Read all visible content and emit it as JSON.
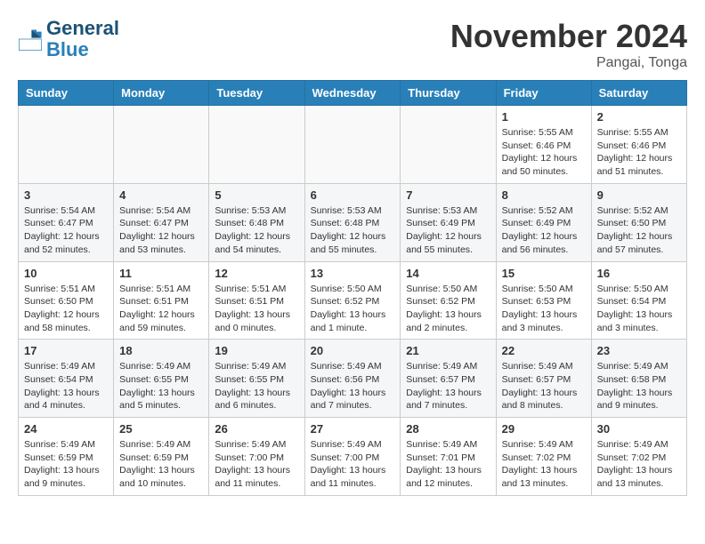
{
  "header": {
    "logo_line1": "General",
    "logo_line2": "Blue",
    "month_title": "November 2024",
    "location": "Pangai, Tonga"
  },
  "weekdays": [
    "Sunday",
    "Monday",
    "Tuesday",
    "Wednesday",
    "Thursday",
    "Friday",
    "Saturday"
  ],
  "weeks": [
    [
      {
        "day": "",
        "detail": ""
      },
      {
        "day": "",
        "detail": ""
      },
      {
        "day": "",
        "detail": ""
      },
      {
        "day": "",
        "detail": ""
      },
      {
        "day": "",
        "detail": ""
      },
      {
        "day": "1",
        "detail": "Sunrise: 5:55 AM\nSunset: 6:46 PM\nDaylight: 12 hours and 50 minutes."
      },
      {
        "day": "2",
        "detail": "Sunrise: 5:55 AM\nSunset: 6:46 PM\nDaylight: 12 hours and 51 minutes."
      }
    ],
    [
      {
        "day": "3",
        "detail": "Sunrise: 5:54 AM\nSunset: 6:47 PM\nDaylight: 12 hours and 52 minutes."
      },
      {
        "day": "4",
        "detail": "Sunrise: 5:54 AM\nSunset: 6:47 PM\nDaylight: 12 hours and 53 minutes."
      },
      {
        "day": "5",
        "detail": "Sunrise: 5:53 AM\nSunset: 6:48 PM\nDaylight: 12 hours and 54 minutes."
      },
      {
        "day": "6",
        "detail": "Sunrise: 5:53 AM\nSunset: 6:48 PM\nDaylight: 12 hours and 55 minutes."
      },
      {
        "day": "7",
        "detail": "Sunrise: 5:53 AM\nSunset: 6:49 PM\nDaylight: 12 hours and 55 minutes."
      },
      {
        "day": "8",
        "detail": "Sunrise: 5:52 AM\nSunset: 6:49 PM\nDaylight: 12 hours and 56 minutes."
      },
      {
        "day": "9",
        "detail": "Sunrise: 5:52 AM\nSunset: 6:50 PM\nDaylight: 12 hours and 57 minutes."
      }
    ],
    [
      {
        "day": "10",
        "detail": "Sunrise: 5:51 AM\nSunset: 6:50 PM\nDaylight: 12 hours and 58 minutes."
      },
      {
        "day": "11",
        "detail": "Sunrise: 5:51 AM\nSunset: 6:51 PM\nDaylight: 12 hours and 59 minutes."
      },
      {
        "day": "12",
        "detail": "Sunrise: 5:51 AM\nSunset: 6:51 PM\nDaylight: 13 hours and 0 minutes."
      },
      {
        "day": "13",
        "detail": "Sunrise: 5:50 AM\nSunset: 6:52 PM\nDaylight: 13 hours and 1 minute."
      },
      {
        "day": "14",
        "detail": "Sunrise: 5:50 AM\nSunset: 6:52 PM\nDaylight: 13 hours and 2 minutes."
      },
      {
        "day": "15",
        "detail": "Sunrise: 5:50 AM\nSunset: 6:53 PM\nDaylight: 13 hours and 3 minutes."
      },
      {
        "day": "16",
        "detail": "Sunrise: 5:50 AM\nSunset: 6:54 PM\nDaylight: 13 hours and 3 minutes."
      }
    ],
    [
      {
        "day": "17",
        "detail": "Sunrise: 5:49 AM\nSunset: 6:54 PM\nDaylight: 13 hours and 4 minutes."
      },
      {
        "day": "18",
        "detail": "Sunrise: 5:49 AM\nSunset: 6:55 PM\nDaylight: 13 hours and 5 minutes."
      },
      {
        "day": "19",
        "detail": "Sunrise: 5:49 AM\nSunset: 6:55 PM\nDaylight: 13 hours and 6 minutes."
      },
      {
        "day": "20",
        "detail": "Sunrise: 5:49 AM\nSunset: 6:56 PM\nDaylight: 13 hours and 7 minutes."
      },
      {
        "day": "21",
        "detail": "Sunrise: 5:49 AM\nSunset: 6:57 PM\nDaylight: 13 hours and 7 minutes."
      },
      {
        "day": "22",
        "detail": "Sunrise: 5:49 AM\nSunset: 6:57 PM\nDaylight: 13 hours and 8 minutes."
      },
      {
        "day": "23",
        "detail": "Sunrise: 5:49 AM\nSunset: 6:58 PM\nDaylight: 13 hours and 9 minutes."
      }
    ],
    [
      {
        "day": "24",
        "detail": "Sunrise: 5:49 AM\nSunset: 6:59 PM\nDaylight: 13 hours and 9 minutes."
      },
      {
        "day": "25",
        "detail": "Sunrise: 5:49 AM\nSunset: 6:59 PM\nDaylight: 13 hours and 10 minutes."
      },
      {
        "day": "26",
        "detail": "Sunrise: 5:49 AM\nSunset: 7:00 PM\nDaylight: 13 hours and 11 minutes."
      },
      {
        "day": "27",
        "detail": "Sunrise: 5:49 AM\nSunset: 7:00 PM\nDaylight: 13 hours and 11 minutes."
      },
      {
        "day": "28",
        "detail": "Sunrise: 5:49 AM\nSunset: 7:01 PM\nDaylight: 13 hours and 12 minutes."
      },
      {
        "day": "29",
        "detail": "Sunrise: 5:49 AM\nSunset: 7:02 PM\nDaylight: 13 hours and 13 minutes."
      },
      {
        "day": "30",
        "detail": "Sunrise: 5:49 AM\nSunset: 7:02 PM\nDaylight: 13 hours and 13 minutes."
      }
    ]
  ]
}
